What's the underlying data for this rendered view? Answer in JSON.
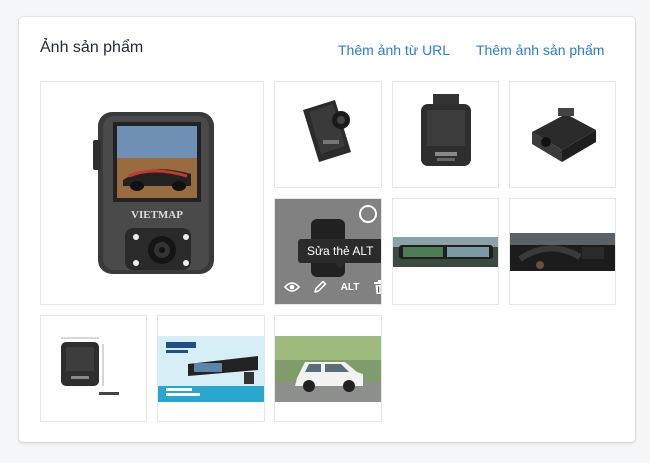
{
  "section": {
    "title": "Ảnh sản phẩm",
    "add_from_url": "Thêm ảnh từ URL",
    "add_image": "Thêm ảnh sản phẩm"
  },
  "image_grid": {
    "hovered_tile": {
      "tooltip": "Sửa thẻ ALT",
      "alt_label": "ALT"
    },
    "images": [
      {
        "name": "main-product-image",
        "brand_text": "VIETMAP"
      },
      {
        "name": "product-thumb-side-view"
      },
      {
        "name": "product-thumb-back-view"
      },
      {
        "name": "product-thumb-top-view"
      },
      {
        "name": "product-thumb-hovered"
      },
      {
        "name": "product-thumb-mirror-in-car"
      },
      {
        "name": "product-thumb-car-interior"
      },
      {
        "name": "product-thumb-dimensions"
      },
      {
        "name": "product-thumb-mirror-banner"
      },
      {
        "name": "product-thumb-white-car"
      }
    ]
  },
  "colors": {
    "link": "#2b7bd1",
    "title": "#212b36",
    "border": "#e4e7ea"
  }
}
